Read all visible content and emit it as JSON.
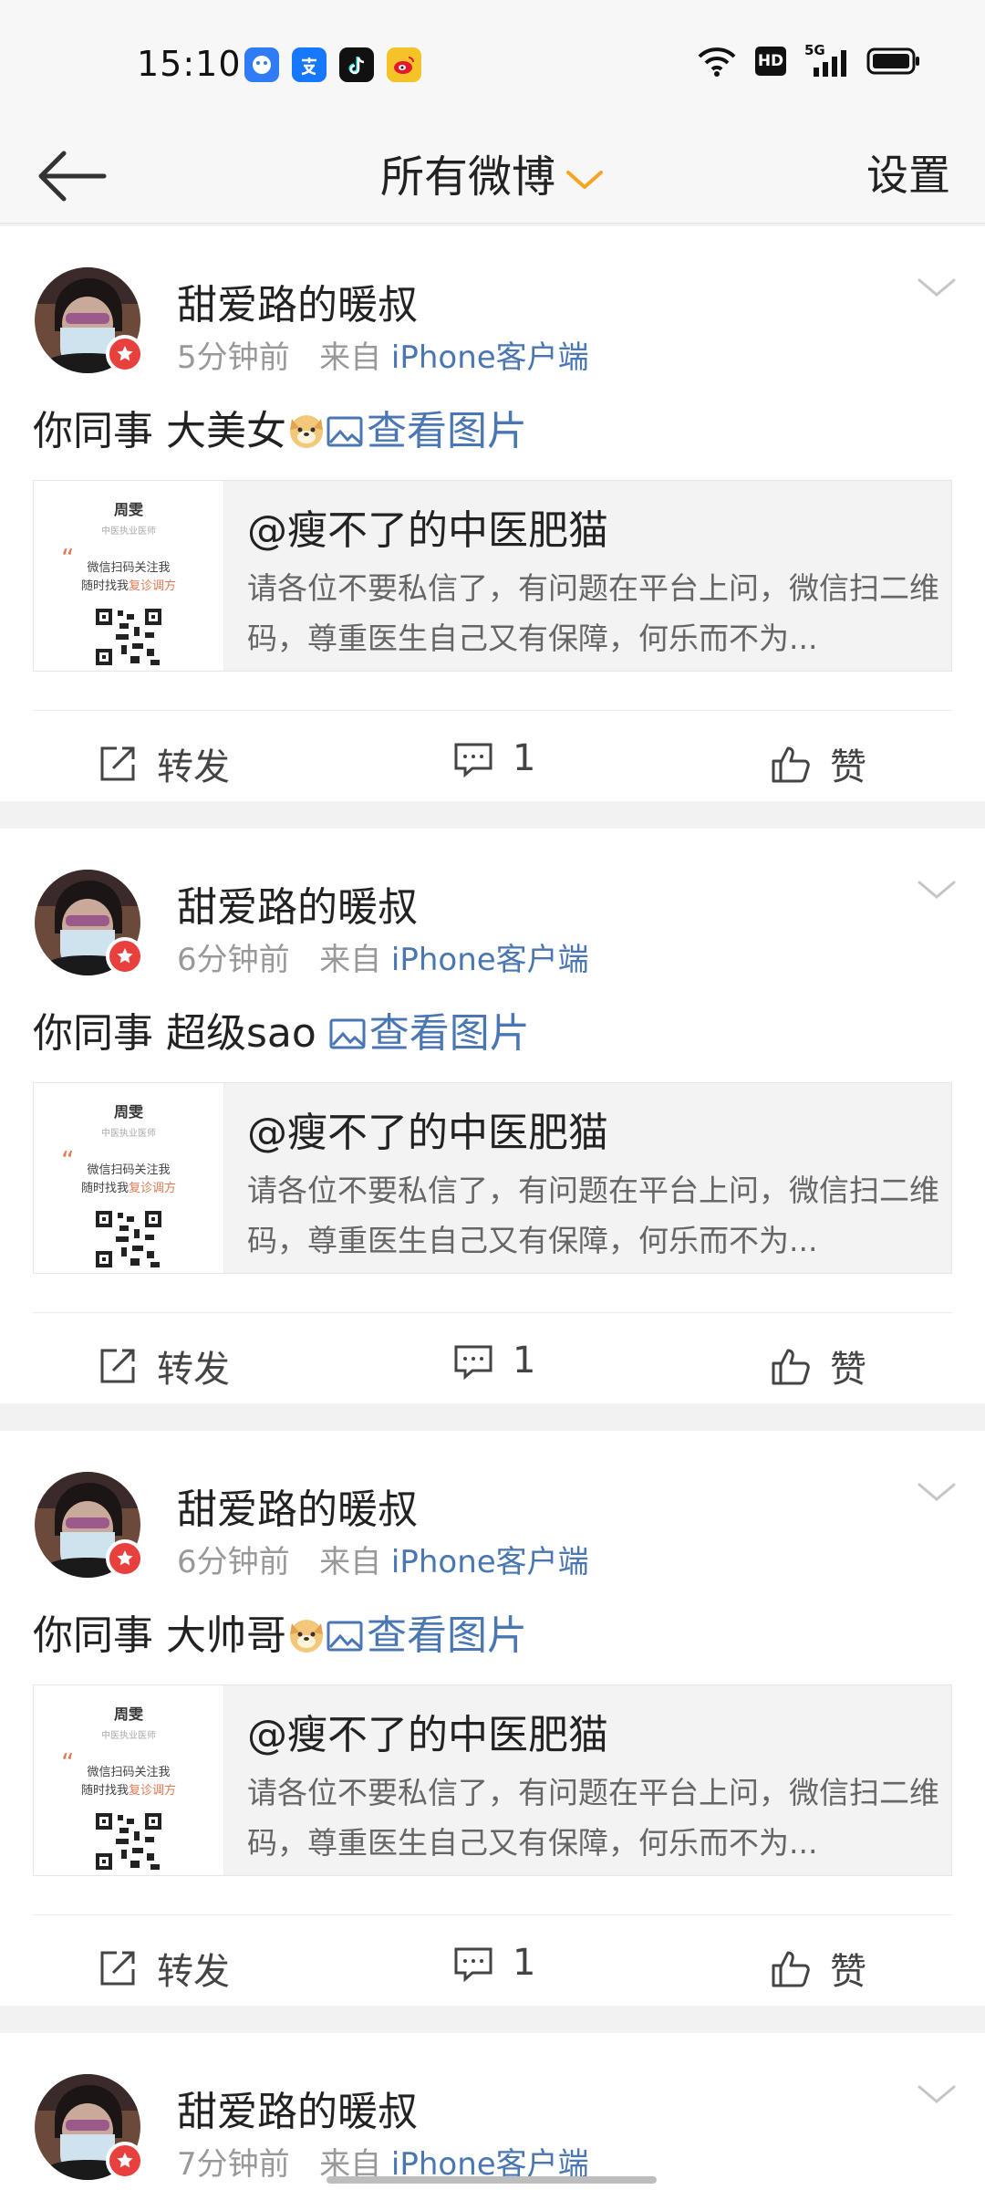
{
  "status_bar": {
    "time": "15:10",
    "apps": [
      {
        "icon": "baidu-app-icon",
        "color": "#2f7cf6"
      },
      {
        "icon": "alipay-app-icon",
        "color": "#1677ff"
      },
      {
        "icon": "tiktok-app-icon",
        "color": "#111111"
      },
      {
        "icon": "weibo-app-icon",
        "color": "#f5c227"
      }
    ],
    "system_icons": [
      "wifi-icon",
      "hd-icon",
      "5g-signal-icon",
      "battery-icon"
    ],
    "hd_label": "HD",
    "network_label": "5G"
  },
  "nav": {
    "title": "所有微博",
    "settings_label": "设置"
  },
  "posts": [
    {
      "username": "甜爱路的暖叔",
      "time": "5分钟前",
      "from_label": "来自",
      "source": "iPhone客户端",
      "text": "你同事 大美女",
      "has_emoji": true,
      "view_image_label": "查看图片",
      "card": {
        "title": "@瘦不了的中医肥猫",
        "desc": "请各位不要私信了，有问题在平台上问，微信扫二维码，尊重医生自己又有保障，何乐而不为...",
        "thumb_name": "周雯",
        "thumb_sub": "中医执业医师",
        "thumb_line1": "微信扫码关注我",
        "thumb_line2_a": "随时找我",
        "thumb_line2_b": "复诊调方"
      },
      "repost_label": "转发",
      "comment_count": "1",
      "like_label": "赞"
    },
    {
      "username": "甜爱路的暖叔",
      "time": "6分钟前",
      "from_label": "来自",
      "source": "iPhone客户端",
      "text": "你同事 超级sao",
      "has_emoji": false,
      "view_image_label": "查看图片",
      "card": {
        "title": "@瘦不了的中医肥猫",
        "desc": "请各位不要私信了，有问题在平台上问，微信扫二维码，尊重医生自己又有保障，何乐而不为...",
        "thumb_name": "周雯",
        "thumb_sub": "中医执业医师",
        "thumb_line1": "微信扫码关注我",
        "thumb_line2_a": "随时找我",
        "thumb_line2_b": "复诊调方"
      },
      "repost_label": "转发",
      "comment_count": "1",
      "like_label": "赞"
    },
    {
      "username": "甜爱路的暖叔",
      "time": "6分钟前",
      "from_label": "来自",
      "source": "iPhone客户端",
      "text": "你同事 大帅哥",
      "has_emoji": true,
      "view_image_label": "查看图片",
      "card": {
        "title": "@瘦不了的中医肥猫",
        "desc": "请各位不要私信了，有问题在平台上问，微信扫二维码，尊重医生自己又有保障，何乐而不为...",
        "thumb_name": "周雯",
        "thumb_sub": "中医执业医师",
        "thumb_line1": "微信扫码关注我",
        "thumb_line2_a": "随时找我",
        "thumb_line2_b": "复诊调方"
      },
      "repost_label": "转发",
      "comment_count": "1",
      "like_label": "赞"
    },
    {
      "username": "甜爱路的暖叔",
      "time": "7分钟前",
      "from_label": "来自",
      "source": "iPhone客户端"
    }
  ],
  "colors": {
    "link": "#4a76b3",
    "meta": "#999999",
    "accent_orange": "#f5a623",
    "badge_red": "#e8413d",
    "background": "#f2f2f2"
  }
}
